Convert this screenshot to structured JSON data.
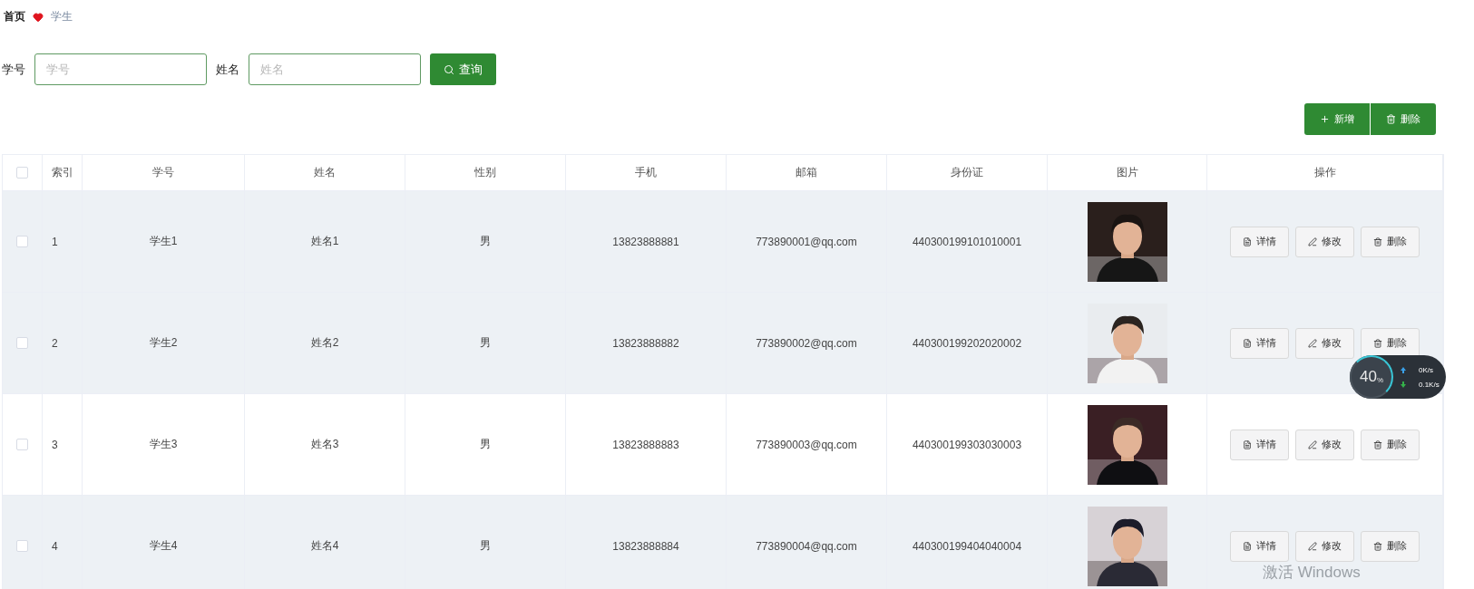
{
  "breadcrumb": [
    {
      "label": "首页",
      "current": false
    },
    {
      "label": "学生",
      "current": true
    }
  ],
  "search": {
    "fields": [
      {
        "label": "学号",
        "placeholder": "学号"
      },
      {
        "label": "姓名",
        "placeholder": "姓名"
      }
    ],
    "button": "查询"
  },
  "toolbar": [
    {
      "kind": "add",
      "label": "新增"
    },
    {
      "kind": "delete",
      "label": "删除"
    }
  ],
  "table": {
    "columns": [
      "索引",
      "学号",
      "姓名",
      "性别",
      "手机",
      "邮箱",
      "身份证",
      "图片",
      "操作"
    ],
    "header_checked": false,
    "rows": [
      {
        "checked": false,
        "highlighted": true,
        "cells": [
          "1",
          "学生1",
          "姓名1",
          "男",
          "13823888881",
          "773890001@qq.com",
          "440300199101010001"
        ],
        "picture": {
          "kind": "picture"
        },
        "actions": [
          {
            "kind": "detail",
            "label": "详情"
          },
          {
            "kind": "edit",
            "label": "修改"
          },
          {
            "kind": "delete",
            "label": "删除"
          }
        ]
      },
      {
        "checked": false,
        "highlighted": true,
        "cells": [
          "2",
          "学生2",
          "姓名2",
          "男",
          "13823888882",
          "773890002@qq.com",
          "440300199202020002"
        ],
        "picture": {
          "kind": "picture"
        },
        "actions": [
          {
            "kind": "detail",
            "label": "详情"
          },
          {
            "kind": "edit",
            "label": "修改"
          },
          {
            "kind": "delete",
            "label": "删除"
          }
        ]
      },
      {
        "checked": false,
        "highlighted": false,
        "cells": [
          "3",
          "学生3",
          "姓名3",
          "男",
          "13823888883",
          "773890003@qq.com",
          "440300199303030003"
        ],
        "picture": {
          "kind": "picture"
        },
        "actions": [
          {
            "kind": "detail",
            "label": "详情"
          },
          {
            "kind": "edit",
            "label": "修改"
          },
          {
            "kind": "delete",
            "label": "删除"
          }
        ]
      },
      {
        "checked": false,
        "highlighted": true,
        "cells": [
          "4",
          "学生4",
          "姓名4",
          "男",
          "13823888884",
          "773890004@qq.com",
          "440300199404040004"
        ],
        "picture": {
          "kind": "picture"
        },
        "actions": [
          {
            "kind": "detail",
            "label": "详情"
          },
          {
            "kind": "edit",
            "label": "修改"
          },
          {
            "kind": "delete",
            "label": "删除"
          }
        ]
      }
    ]
  },
  "net_widget": {
    "percent": "40",
    "unit": "%",
    "up": "0K/s",
    "down": "0.1K/s"
  },
  "os_notice": "激活 Windows"
}
